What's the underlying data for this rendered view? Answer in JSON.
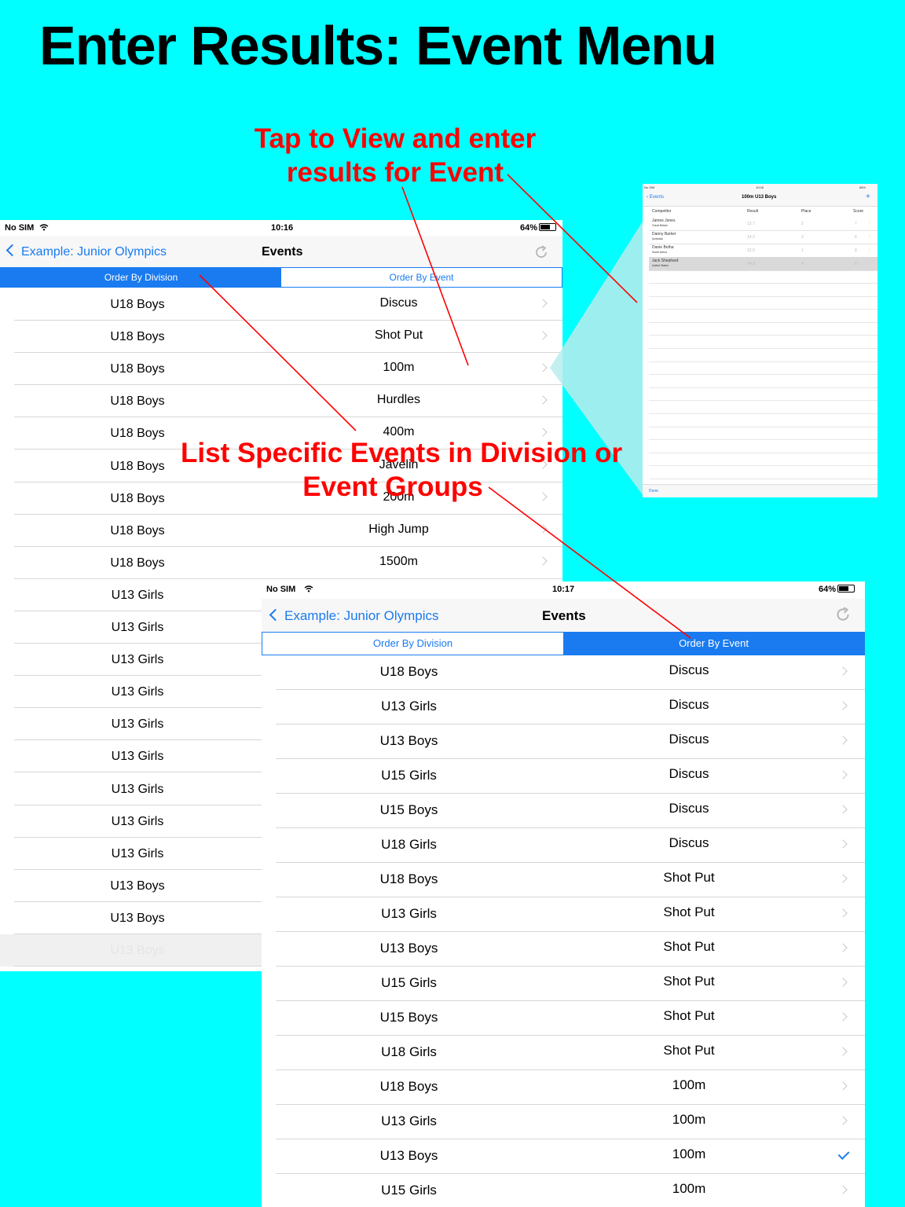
{
  "headline": "Enter Results: Event Menu",
  "callouts": {
    "tap_view": [
      "Tap to View and enter",
      "results for Event"
    ],
    "list_specific": [
      "List Specific Events in Division or",
      "Event Groups"
    ]
  },
  "colors": {
    "background": "#00ffff",
    "callout": "#ff0000",
    "ios_blue": "#1a7bf0"
  },
  "screen1": {
    "status": {
      "carrier": "No SIM",
      "time": "10:16",
      "battery": "64%"
    },
    "nav": {
      "back_label": "Example: Junior Olympics",
      "title": "Events"
    },
    "segments": [
      {
        "label": "Order By Division",
        "selected": true
      },
      {
        "label": "Order By Event",
        "selected": false
      }
    ],
    "rows": [
      {
        "division": "U18 Boys",
        "event": "Discus"
      },
      {
        "division": "U18 Boys",
        "event": "Shot Put"
      },
      {
        "division": "U18 Boys",
        "event": "100m"
      },
      {
        "division": "U18 Boys",
        "event": "Hurdles"
      },
      {
        "division": "U18 Boys",
        "event": "400m"
      },
      {
        "division": "U18 Boys",
        "event": "Javelin"
      },
      {
        "division": "U18 Boys",
        "event": "200m"
      },
      {
        "division": "U18 Boys",
        "event": "High Jump"
      },
      {
        "division": "U18 Boys",
        "event": "1500m"
      },
      {
        "division": "U13 Girls",
        "event": ""
      },
      {
        "division": "U13 Girls",
        "event": ""
      },
      {
        "division": "U13 Girls",
        "event": ""
      },
      {
        "division": "U13 Girls",
        "event": ""
      },
      {
        "division": "U13 Girls",
        "event": ""
      },
      {
        "division": "U13 Girls",
        "event": ""
      },
      {
        "division": "U13 Girls",
        "event": ""
      },
      {
        "division": "U13 Girls",
        "event": ""
      },
      {
        "division": "U13 Girls",
        "event": ""
      },
      {
        "division": "U13 Boys",
        "event": ""
      },
      {
        "division": "U13 Boys",
        "event": ""
      },
      {
        "division": "U13 Boys",
        "event": ""
      }
    ]
  },
  "screen2": {
    "status": {
      "carrier": "No SIM",
      "time": "10:17",
      "battery": "64%"
    },
    "nav": {
      "back_label": "Example: Junior Olympics",
      "title": "Events"
    },
    "segments": [
      {
        "label": "Order By Division",
        "selected": false
      },
      {
        "label": "Order By Event",
        "selected": true
      }
    ],
    "rows": [
      {
        "division": "U18 Boys",
        "event": "Discus",
        "accessory": "chevron"
      },
      {
        "division": "U13 Girls",
        "event": "Discus",
        "accessory": "chevron"
      },
      {
        "division": "U13 Boys",
        "event": "Discus",
        "accessory": "chevron"
      },
      {
        "division": "U15 Girls",
        "event": "Discus",
        "accessory": "chevron"
      },
      {
        "division": "U15 Boys",
        "event": "Discus",
        "accessory": "chevron"
      },
      {
        "division": "U18 Girls",
        "event": "Discus",
        "accessory": "chevron"
      },
      {
        "division": "U18 Boys",
        "event": "Shot Put",
        "accessory": "chevron"
      },
      {
        "division": "U13 Girls",
        "event": "Shot Put",
        "accessory": "chevron"
      },
      {
        "division": "U13 Boys",
        "event": "Shot Put",
        "accessory": "chevron"
      },
      {
        "division": "U15 Girls",
        "event": "Shot Put",
        "accessory": "chevron"
      },
      {
        "division": "U15 Boys",
        "event": "Shot Put",
        "accessory": "chevron"
      },
      {
        "division": "U18 Girls",
        "event": "Shot Put",
        "accessory": "chevron"
      },
      {
        "division": "U18 Boys",
        "event": "100m",
        "accessory": "chevron"
      },
      {
        "division": "U13 Girls",
        "event": "100m",
        "accessory": "chevron"
      },
      {
        "division": "U13 Boys",
        "event": "100m",
        "accessory": "checkmark"
      },
      {
        "division": "U15 Girls",
        "event": "100m",
        "accessory": "chevron"
      }
    ]
  },
  "detail": {
    "status": {
      "carrier": "No SIM",
      "time": "10:06",
      "battery": "88%"
    },
    "back_label": "Events",
    "title": "100m U13 Boys",
    "add_label": "+",
    "columns": [
      "Competitor",
      "Result",
      "Place",
      "Score"
    ],
    "rows": [
      {
        "name": "James Jones",
        "country": "Great Britain",
        "result": "13.7",
        "place": "2",
        "score": "7"
      },
      {
        "name": "Danny Barker",
        "country": "Australia",
        "result": "14.2",
        "place": "3",
        "score": "6"
      },
      {
        "name": "Danie Botha",
        "country": "South Africa",
        "result": "12.9",
        "place": "1",
        "score": "8"
      },
      {
        "name": "Jack Shephard",
        "country": "United States",
        "result": "14.3",
        "place": "4",
        "score": "5"
      }
    ],
    "done_label": "Done"
  }
}
